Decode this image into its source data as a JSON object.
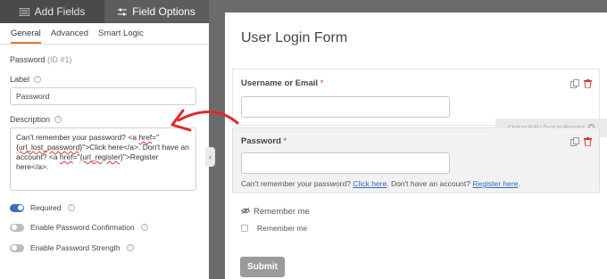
{
  "top_tabs": [
    {
      "label": "Add Fields",
      "icon": "list-icon",
      "active": false
    },
    {
      "label": "Field Options",
      "icon": "sliders-icon",
      "active": true
    }
  ],
  "sub_tabs": [
    "General",
    "Advanced",
    "Smart Logic"
  ],
  "field": {
    "name": "Password",
    "id_text": "(ID #1)",
    "label_heading": "Label",
    "label_value": "Password",
    "description_heading": "Description",
    "description_parts": {
      "p1": "Can't remember your password? <a ",
      "p2": "href",
      "p3": "=\"",
      "p4": "{url_lost_password}",
      "p5": "\">Click here</a>. Don't have an account? <a ",
      "p6": "href",
      "p7": "=\"",
      "p8": "{url_register}",
      "p9": "\">Register here</a>."
    }
  },
  "toggles": [
    {
      "label": "Required",
      "on": true
    },
    {
      "label": "Enable Password Confirmation",
      "on": false
    },
    {
      "label": "Enable Password Strength",
      "on": false
    }
  ],
  "form": {
    "title": "User Login Form",
    "username_label": "Username or Email",
    "password_label": "Password",
    "required_mark": "*",
    "hint": "Click to Edit | Drag to Reorder",
    "description": {
      "before": "Can't remember your password?",
      "link1": "Click here",
      "middle": ". Don't have an account?",
      "link2": "Register here",
      "after": "."
    },
    "remember_heading": "Remember me",
    "remember_option": "Remember me",
    "submit_label": "Submit"
  },
  "colors": {
    "accent_orange": "#e27730",
    "toggle_on": "#3a6fb6",
    "required_red": "#d63638",
    "link_blue": "#2b6cc4",
    "arrow_red": "#e0282a"
  }
}
